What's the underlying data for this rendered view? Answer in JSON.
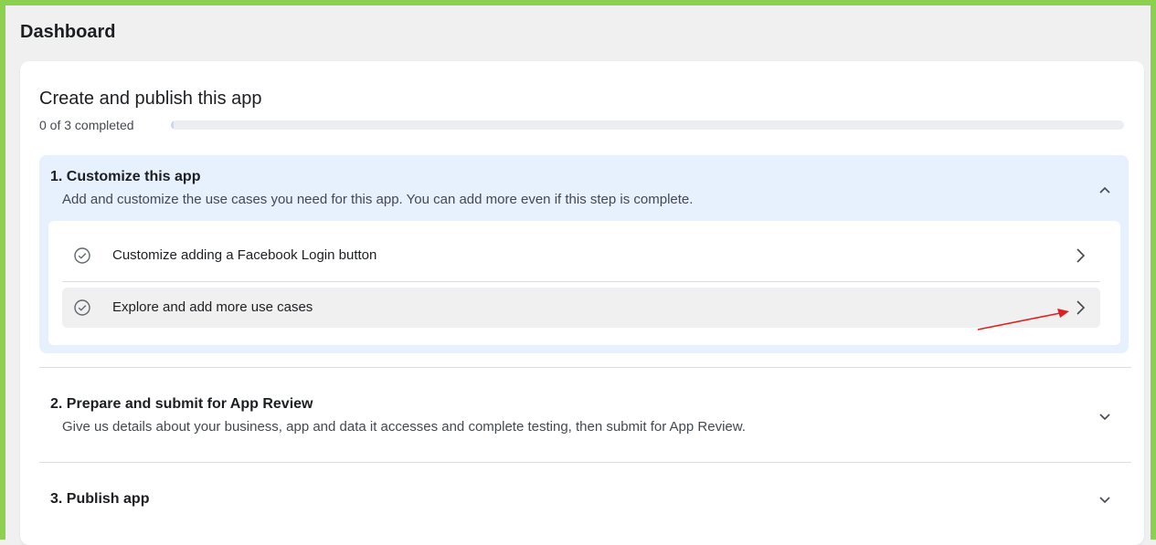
{
  "page": {
    "title": "Dashboard"
  },
  "card": {
    "title": "Create and publish this app",
    "progress_text": "0 of 3 completed",
    "progress_completed": 0,
    "progress_total": 3
  },
  "steps": [
    {
      "title": "1. Customize this app",
      "description": "Add and customize the use cases you need for this app. You can add more even if this step is complete.",
      "expanded": true,
      "tasks": [
        {
          "label": "Customize adding a Facebook Login button",
          "icon": "check-circle-icon"
        },
        {
          "label": "Explore and add more use cases",
          "icon": "check-circle-icon"
        }
      ]
    },
    {
      "title": "2. Prepare and submit for App Review",
      "description": "Give us details about your business, app and data it accesses and complete testing, then submit for App Review.",
      "expanded": false
    },
    {
      "title": "3. Publish app",
      "expanded": false
    }
  ],
  "colors": {
    "frame_border": "#8bd14f",
    "expanded_section_bg": "#e7f0fd",
    "annotation_arrow": "#e02020"
  }
}
